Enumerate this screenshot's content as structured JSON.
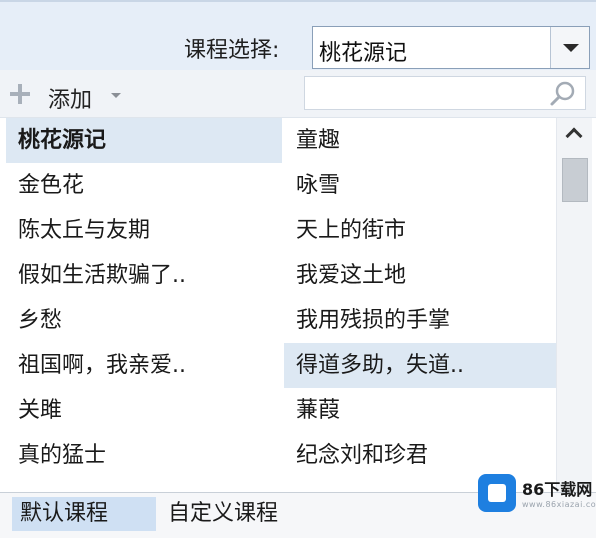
{
  "selector": {
    "label": "课程选择:",
    "value": "桃花源记"
  },
  "toolbar": {
    "add_label": "添加",
    "search_placeholder": ""
  },
  "lessons": {
    "left": [
      "桃花源记",
      "金色花",
      "陈太丘与友期",
      "假如生活欺骗了..",
      "乡愁",
      "祖国啊，我亲爱..",
      "关雎",
      "真的猛士"
    ],
    "right": [
      "童趣",
      "咏雪",
      "天上的街市",
      "我爱这土地",
      "我用残损的手掌",
      "得道多助，失道..",
      "蒹葭",
      "纪念刘和珍君"
    ],
    "selected": "桃花源记",
    "highlighted": "得道多助，失道.."
  },
  "tabs": {
    "default_label": "默认课程",
    "custom_label": "自定义课程"
  },
  "watermark": {
    "title": "86下载网",
    "subtitle": "www.86xiazai.com"
  },
  "colors": {
    "accent": "#dde8f3",
    "topbar": "#e6eef8",
    "watermark_blue": "#1e7fe0"
  }
}
